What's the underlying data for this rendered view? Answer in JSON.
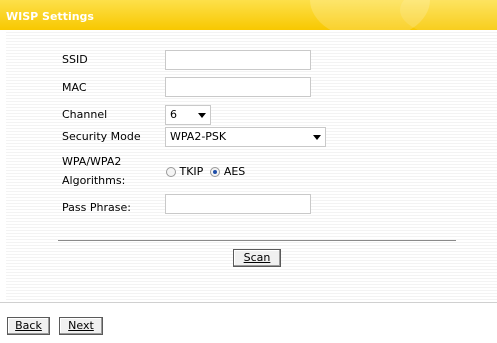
{
  "header": {
    "title": "WISP Settings"
  },
  "form": {
    "ssid_label": "SSID",
    "ssid_value": "",
    "mac_label": "MAC",
    "mac_value": "",
    "channel_label": "Channel",
    "channel_value": "6",
    "security_label": "Security Mode",
    "security_value": "WPA2-PSK",
    "algo_label_line1": "WPA/WPA2",
    "algo_label_line2": "Algorithms:",
    "algo_option1": "TKIP",
    "algo_option2": "AES",
    "algo_selected": "AES",
    "passphrase_label": "Pass Phrase:",
    "passphrase_value": ""
  },
  "scan_label": "Scan",
  "footer": {
    "back_label": "Back",
    "next_label": "Next"
  },
  "colors": {
    "header_bg": "#f8c800",
    "header_text": "#ffffff"
  }
}
